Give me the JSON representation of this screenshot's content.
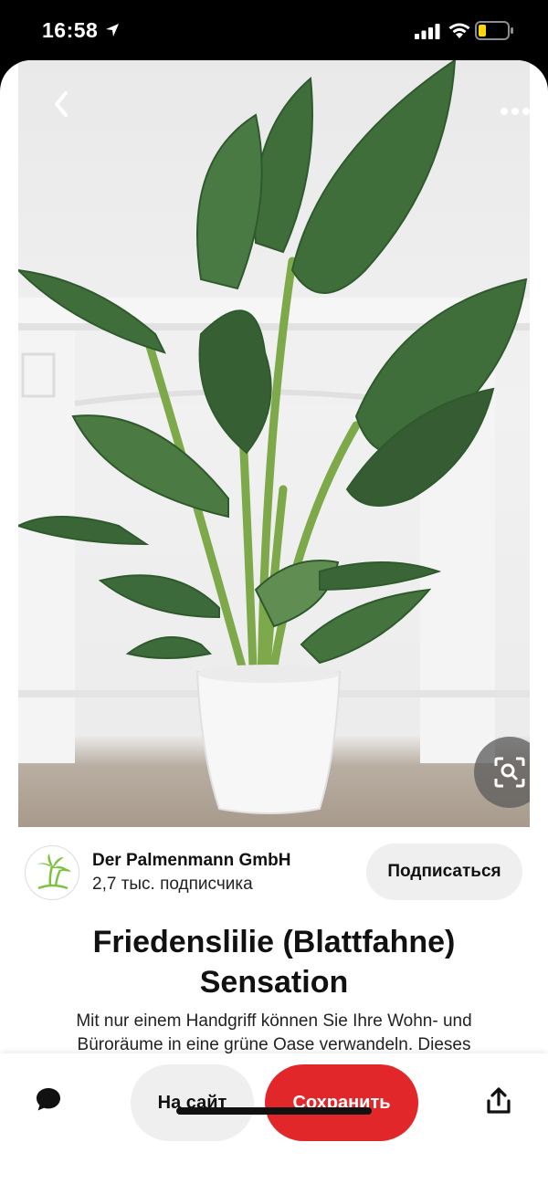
{
  "status_bar": {
    "time": "16:58"
  },
  "creator": {
    "name": "Der Palmenmann GmbH",
    "followers": "2,7 тыс. подписчика",
    "follow_label": "Подписаться"
  },
  "pin": {
    "title": "Friedenslilie (Blattfahne) Sensation",
    "description": "Mit nur einem Handgriff können Sie Ihre Wohn- und Büroräume in eine grüne Oase verwandeln. Dieses"
  },
  "actions": {
    "visit_label": "На сайт",
    "save_label": "Сохранить"
  },
  "icons": {
    "back": "chevron-left-icon",
    "more": "more-horizontal-icon",
    "visual_search": "visual-search-icon",
    "chat": "chat-bubble-icon",
    "share": "share-icon"
  },
  "colors": {
    "save_button": "#e2272b",
    "secondary_button": "#efefef",
    "logo_green": "#7cc242"
  }
}
